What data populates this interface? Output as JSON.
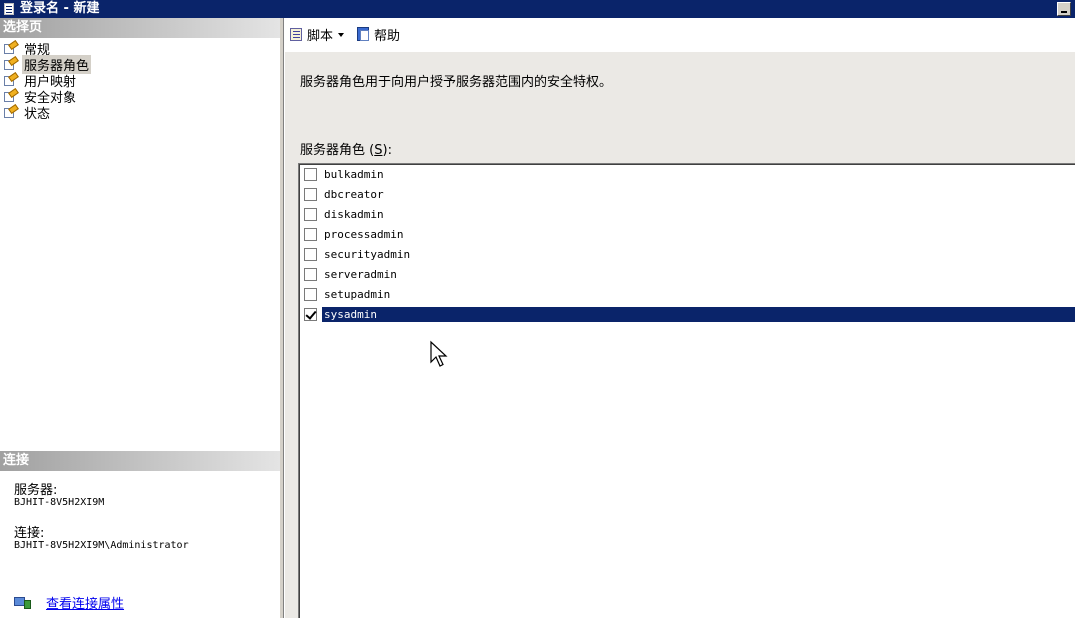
{
  "window": {
    "title": "登录名 - 新建"
  },
  "left_panel": {
    "pages_header": "选择页",
    "pages": [
      {
        "label": "常规",
        "selected": false
      },
      {
        "label": "服务器角色",
        "selected": true
      },
      {
        "label": "用户映射",
        "selected": false
      },
      {
        "label": "安全对象",
        "selected": false
      },
      {
        "label": "状态",
        "selected": false
      }
    ],
    "connection_header": "连接",
    "server_label": "服务器:",
    "server_value": "BJHIT-8V5H2XI9M",
    "connection_label": "连接:",
    "connection_value": "BJHIT-8V5H2XI9M\\Administrator",
    "view_props_link": "查看连接属性"
  },
  "toolbar": {
    "script_label": "脚本",
    "help_label": "帮助"
  },
  "main": {
    "description": "服务器角色用于向用户授予服务器范围内的安全特权。",
    "roles_label_prefix": "服务器角色",
    "roles_label_hotkey": "S",
    "roles_label_suffix": "):",
    "roles_label_open": "(",
    "roles": [
      {
        "name": "bulkadmin",
        "checked": false
      },
      {
        "name": "dbcreator",
        "checked": false
      },
      {
        "name": "diskadmin",
        "checked": false
      },
      {
        "name": "processadmin",
        "checked": false
      },
      {
        "name": "securityadmin",
        "checked": false
      },
      {
        "name": "serveradmin",
        "checked": false
      },
      {
        "name": "setupadmin",
        "checked": false
      },
      {
        "name": "sysadmin",
        "checked": true
      }
    ],
    "selected_role": "sysadmin"
  },
  "icons": {
    "app": "document-icon",
    "page": "properties-page-icon",
    "script": "script-icon",
    "help": "help-icon",
    "connection": "connection-properties-icon",
    "cursor": "mouse-pointer-icon"
  },
  "colors": {
    "titlebar": "#0a246a",
    "selection": "#0a246a",
    "panel_bg": "#ebe9e5",
    "link": "#0000ee"
  }
}
